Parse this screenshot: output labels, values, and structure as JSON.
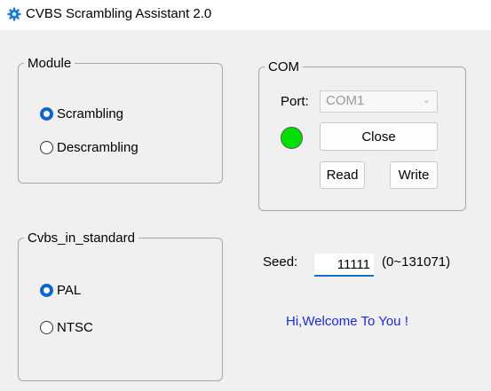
{
  "window": {
    "title": "CVBS Scrambling Assistant 2.0",
    "icon": "gear-icon",
    "icon_color": "#1e73d8"
  },
  "module": {
    "legend": "Module",
    "options": [
      {
        "label": "Scrambling",
        "checked": true
      },
      {
        "label": "Descrambling",
        "checked": false
      }
    ]
  },
  "com": {
    "legend": "COM",
    "port_label": "Port:",
    "port_value": "COM1",
    "status_color": "#00e000",
    "close_label": "Close",
    "read_label": "Read",
    "write_label": "Write"
  },
  "standard": {
    "legend": "Cvbs_in_standard",
    "options": [
      {
        "label": "PAL",
        "checked": true
      },
      {
        "label": "NTSC",
        "checked": false
      }
    ]
  },
  "seed": {
    "label": "Seed:",
    "value": "11111",
    "range": "(0~131071)"
  },
  "welcome": "Hi,Welcome To You !",
  "colors": {
    "accent": "#1066c8",
    "welcome": "#1c2bdc"
  }
}
